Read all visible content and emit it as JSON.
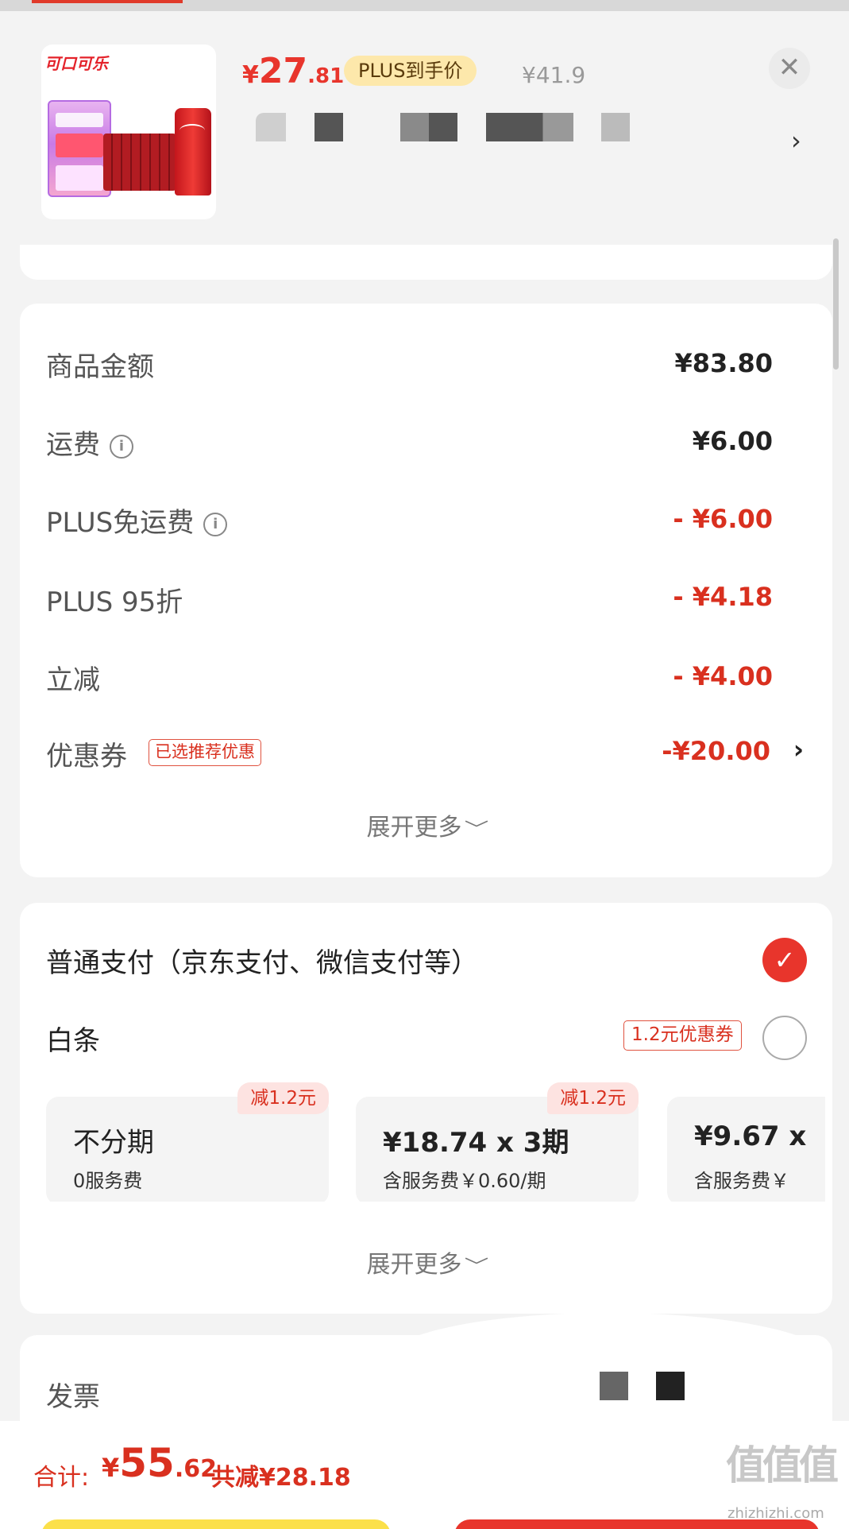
{
  "product": {
    "thumb_logo": "可口可乐",
    "price_yen": "¥",
    "price_int": "27",
    "price_dec": ".81",
    "plus_label": "PLUS到手价",
    "original_price": "¥41.9",
    "close_glyph": "✕",
    "chevron_glyph": "›"
  },
  "price_detail": {
    "rows": [
      {
        "label": "商品金额",
        "value": "¥83.80",
        "red": false
      },
      {
        "label": "运费",
        "value": "¥6.00",
        "red": false,
        "info": true
      },
      {
        "label": "PLUS免运费",
        "value": "- ¥6.00",
        "red": true,
        "info": true
      },
      {
        "label": "PLUS 95折",
        "value": "- ¥4.18",
        "red": true
      },
      {
        "label": "立减",
        "value": "- ¥4.00",
        "red": true
      },
      {
        "label": "优惠券",
        "value": "-¥20.00",
        "red": true
      }
    ],
    "info_glyph": "i",
    "coupon_tag": "已选推荐优惠",
    "coupon_chevron": "›",
    "expand_label": "展开更多",
    "expand_chevron": "﹀"
  },
  "payment": {
    "normal_label": "普通支付（京东支付、微信支付等）",
    "normal_selected": true,
    "check_glyph": "✓",
    "baitiao_label": "白条",
    "baitiao_coupon": "1.2元优惠券",
    "plans": [
      {
        "title": "不分期",
        "sub": "0服务费",
        "tag": "减1.2元"
      },
      {
        "title": "¥18.74 x 3期",
        "sub": "含服务费￥0.60/期",
        "tag": "减1.2元"
      },
      {
        "title": "¥9.67 x",
        "sub": "含服务费￥",
        "tag": ""
      }
    ],
    "expand_label": "展开更多",
    "expand_chevron": "﹀"
  },
  "invoice": {
    "label": "发票"
  },
  "footer": {
    "total_label": "合计:",
    "total_yen": "¥",
    "total_int": "55",
    "total_dec": ".62",
    "saved_label": "共减¥28.18",
    "watermark": "值值值",
    "watermark_url": "zhizhizhi.com"
  },
  "colors": {
    "accent_red": "#e8352c",
    "plus_gold": "#fde8ab",
    "background": "#f3f3f3"
  }
}
